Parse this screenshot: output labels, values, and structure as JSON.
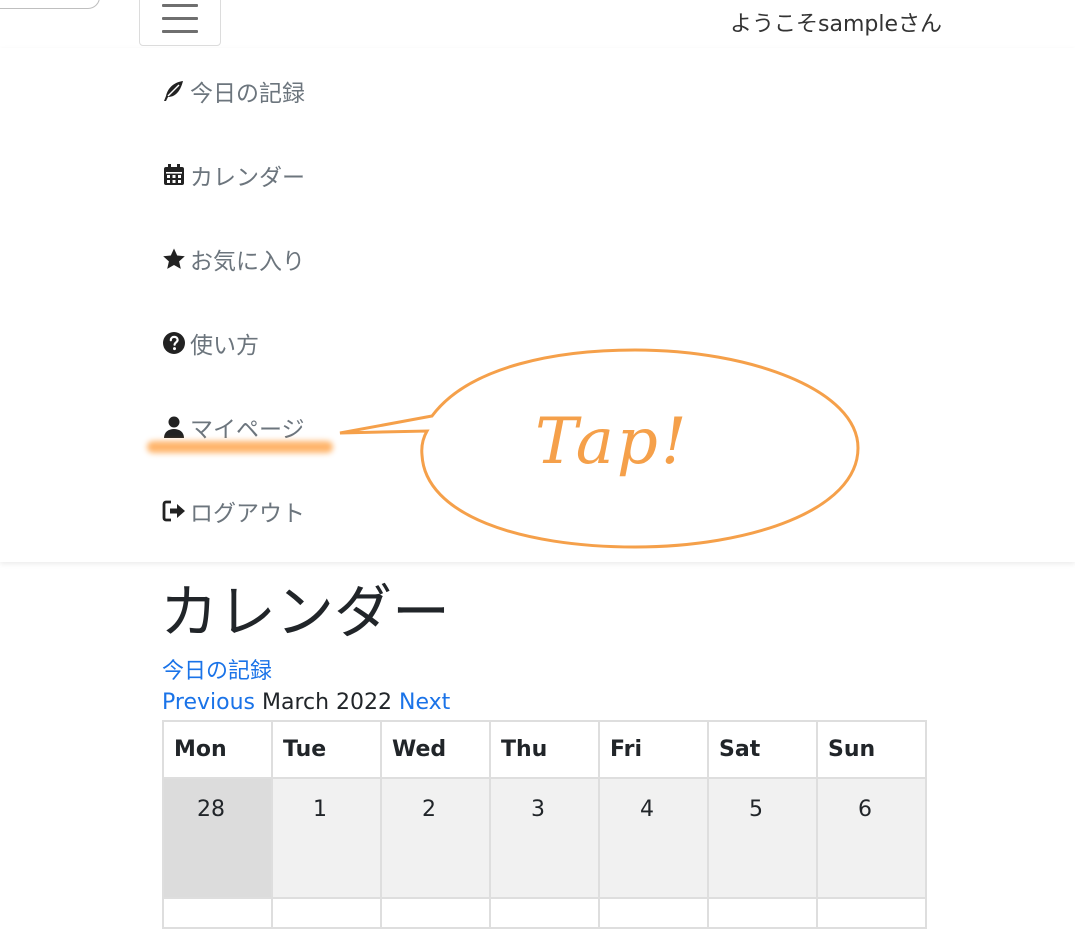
{
  "header": {
    "welcome": "ようこそsampleさん",
    "menu_icon": "hamburger-icon"
  },
  "nav": {
    "items": [
      {
        "label": "今日の記録",
        "icon": "feather-icon"
      },
      {
        "label": "カレンダー",
        "icon": "calendar-icon"
      },
      {
        "label": "お気に入り",
        "icon": "star-icon"
      },
      {
        "label": "使い方",
        "icon": "question-circle-icon"
      },
      {
        "label": "マイページ",
        "icon": "user-icon"
      },
      {
        "label": "ログアウト",
        "icon": "sign-out-icon"
      }
    ]
  },
  "annotation": {
    "text": "Tap!",
    "color": "#f5a04a"
  },
  "main": {
    "title": "カレンダー",
    "today_link": "今日の記録",
    "prev_label": "Previous",
    "month_label": "March 2022",
    "next_label": "Next"
  },
  "calendar": {
    "days": [
      "Mon",
      "Tue",
      "Wed",
      "Thu",
      "Fri",
      "Sat",
      "Sun"
    ],
    "week1": [
      "28",
      "1",
      "2",
      "3",
      "4",
      "5",
      "6"
    ]
  },
  "colors": {
    "link": "#1a73e8",
    "nav_text": "#6c757d",
    "accent": "#f5a04a"
  }
}
